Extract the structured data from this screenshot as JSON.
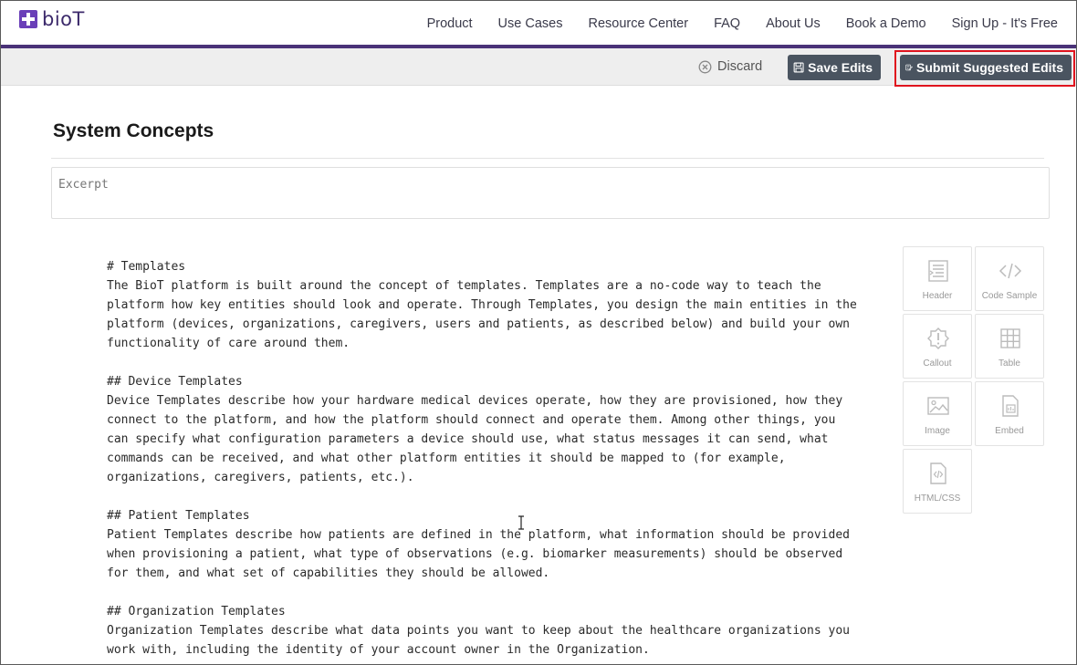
{
  "header": {
    "logo_text": "bioT",
    "nav": [
      "Product",
      "Use Cases",
      "Resource Center",
      "FAQ",
      "About Us",
      "Book a Demo",
      "Sign Up - It's Free"
    ]
  },
  "toolbar": {
    "discard_label": "Discard",
    "save_label": "Save Edits",
    "submit_label": "Submit Suggested Edits"
  },
  "page": {
    "title": "System Concepts",
    "excerpt_placeholder": "Excerpt"
  },
  "editor": {
    "paragraphs": [
      [
        "# Templates",
        "The BioT platform is built around the concept of templates. Templates are a no-code way to teach the",
        "platform how key entities should look and operate. Through Templates, you design the main entities in the",
        "platform (devices, organizations, caregivers, users and patients, as described below) and build your own",
        "functionality of care around them."
      ],
      [
        "## Device Templates",
        "Device Templates describe how your hardware medical devices operate, how they are provisioned, how they",
        "connect to the platform, and how the platform should connect and operate them. Among other things, you",
        "can specify what configuration parameters a device should use, what status messages it can send, what",
        "commands can be received, and what other platform entities it should be mapped to (for example,",
        "organizations, caregivers, patients, etc.)."
      ],
      [
        "## Patient Templates",
        "Patient Templates describe how patients are defined in the platform, what information should be provided",
        "when provisioning a patient, what type of observations (e.g. biomarker measurements) should be observed",
        "for them, and what set of capabilities they should be allowed."
      ],
      [
        "## Organization Templates",
        "Organization Templates describe what data points you want to keep about the healthcare organizations you",
        "work with, including the identity of your account owner in the Organization."
      ]
    ]
  },
  "widgets": {
    "header": "Header",
    "code_sample": "Code Sample",
    "callout": "Callout",
    "table": "Table",
    "image": "Image",
    "embed": "Embed",
    "html_css": "HTML/CSS"
  },
  "colors": {
    "brand_purple": "#4a3278",
    "button_dark": "#4a5460",
    "highlight_red": "#e0141e"
  }
}
